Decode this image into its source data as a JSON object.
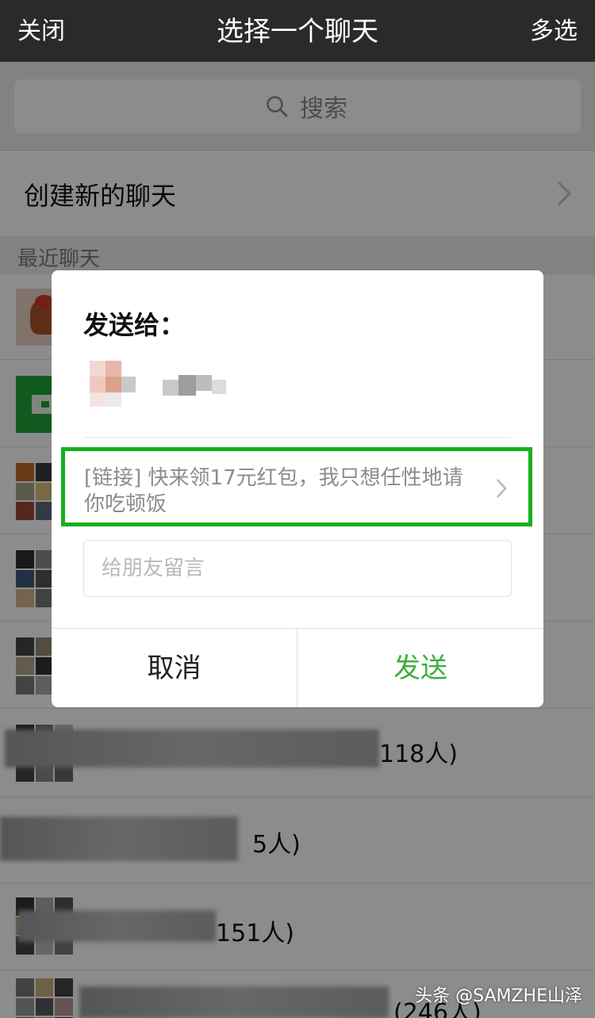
{
  "header": {
    "close_label": "关闭",
    "title": "选择一个聊天",
    "multi_select_label": "多选"
  },
  "search": {
    "placeholder": "搜索"
  },
  "new_chat": {
    "label": "创建新的聊天"
  },
  "recent_label": "最近聊天",
  "chat_list": {
    "items": [
      {
        "count_label": ""
      },
      {
        "count_label": ""
      },
      {
        "count_label": ""
      },
      {
        "count_label": ""
      },
      {
        "count_label": ""
      },
      {
        "count_label": "118人)"
      },
      {
        "count_label": "5人)"
      },
      {
        "count_label": "151人)"
      },
      {
        "count_label": "(246人)"
      }
    ]
  },
  "dialog": {
    "title": "发送给：",
    "link_text": "[链接] 快来领17元红包，我只想任性地请你吃顿饭",
    "message_placeholder": "给朋友留言",
    "cancel_label": "取消",
    "send_label": "发送"
  },
  "colors": {
    "header_bg": "#2a2a2a",
    "highlight_border": "#16b01f",
    "send_green": "#3fae3f"
  },
  "icons": {
    "search": "search-icon",
    "chevron": "chevron-right-icon"
  },
  "watermark": "头条 @SAMZHE山泽"
}
